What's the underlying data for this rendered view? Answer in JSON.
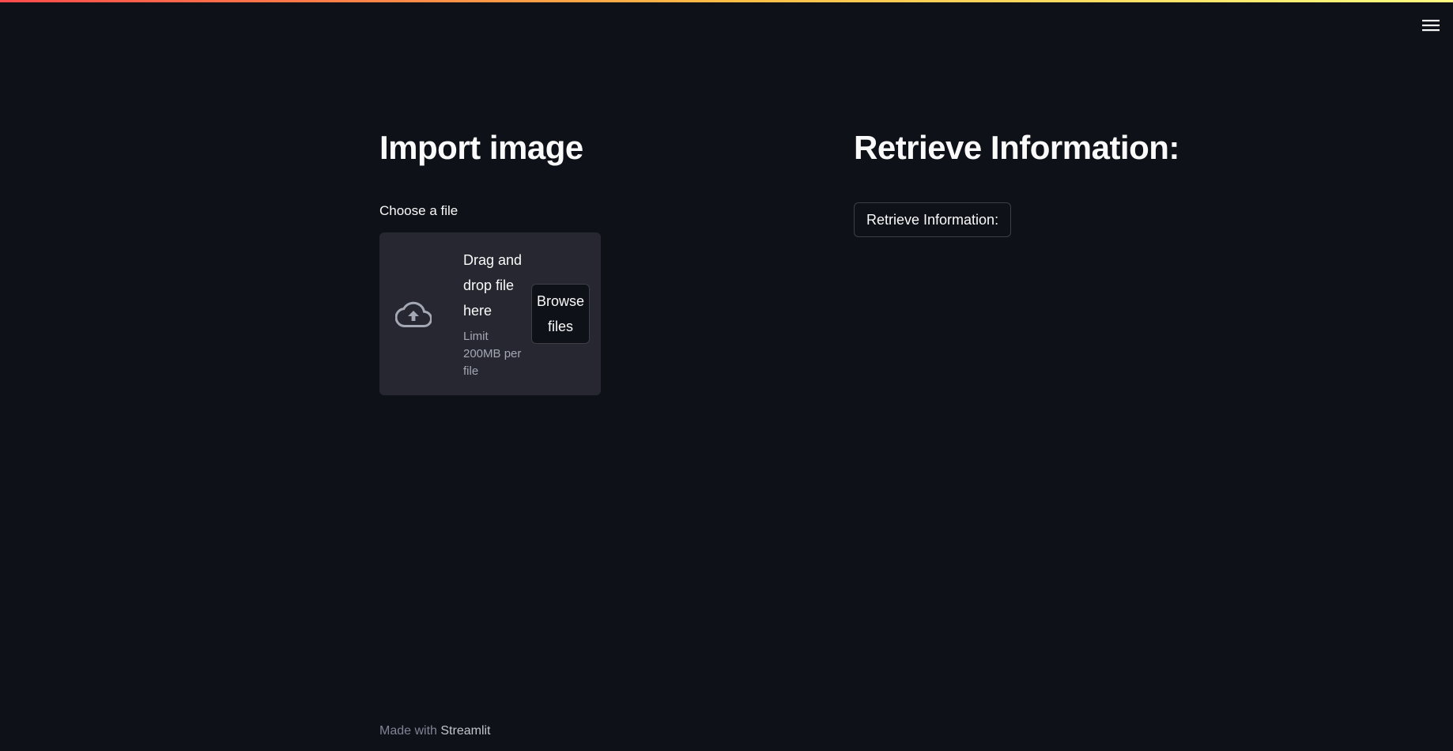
{
  "header": {
    "menu_icon": "hamburger-menu-icon",
    "accent_gradient": [
      "#ff4b4b",
      "#ffbd45",
      "#fffd80"
    ]
  },
  "left": {
    "title": "Import image",
    "uploader": {
      "label": "Choose a file",
      "icon": "cloud-upload-icon",
      "dropzone_text": "Drag and drop file here",
      "limit_text": "Limit 200MB per file",
      "browse_label": "Browse files"
    }
  },
  "right": {
    "title": "Retrieve Information:",
    "button_label": "Retrieve Information:"
  },
  "footer": {
    "prefix": "Made with",
    "brand": "Streamlit"
  },
  "colors": {
    "background": "#0e1117",
    "dropzone": "#262730",
    "text": "#fafafa",
    "muted": "#808495"
  }
}
